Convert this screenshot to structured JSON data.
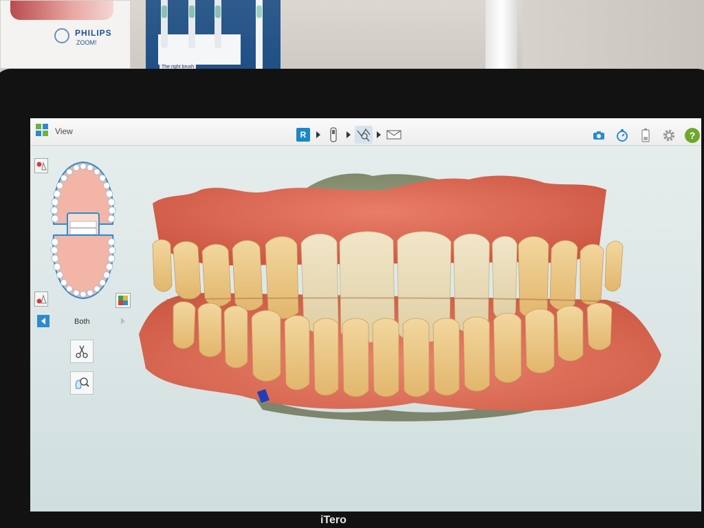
{
  "surroundings": {
    "poster_brand": "PHILIPS",
    "poster_sub": "ZOOM!",
    "display_box_caption": "The right brush",
    "monitor_brand": "iTero"
  },
  "app": {
    "view_title": "View",
    "workflow_steps": [
      {
        "icon": "rx-icon",
        "label": "R"
      },
      {
        "icon": "scanner-icon"
      },
      {
        "icon": "view-tools-icon"
      },
      {
        "icon": "send-icon"
      }
    ],
    "top_tools": [
      "camera-icon",
      "timer-icon",
      "battery-icon",
      "settings-icon",
      "help-icon"
    ],
    "help_label": "?",
    "jaw_selector": {
      "current": "Both"
    }
  },
  "colors": {
    "accent": "#1b87c9",
    "help": "#6da82d",
    "gingiva": "#d96a55",
    "teeth": "#e9c98a",
    "palate": "#8f9478"
  }
}
